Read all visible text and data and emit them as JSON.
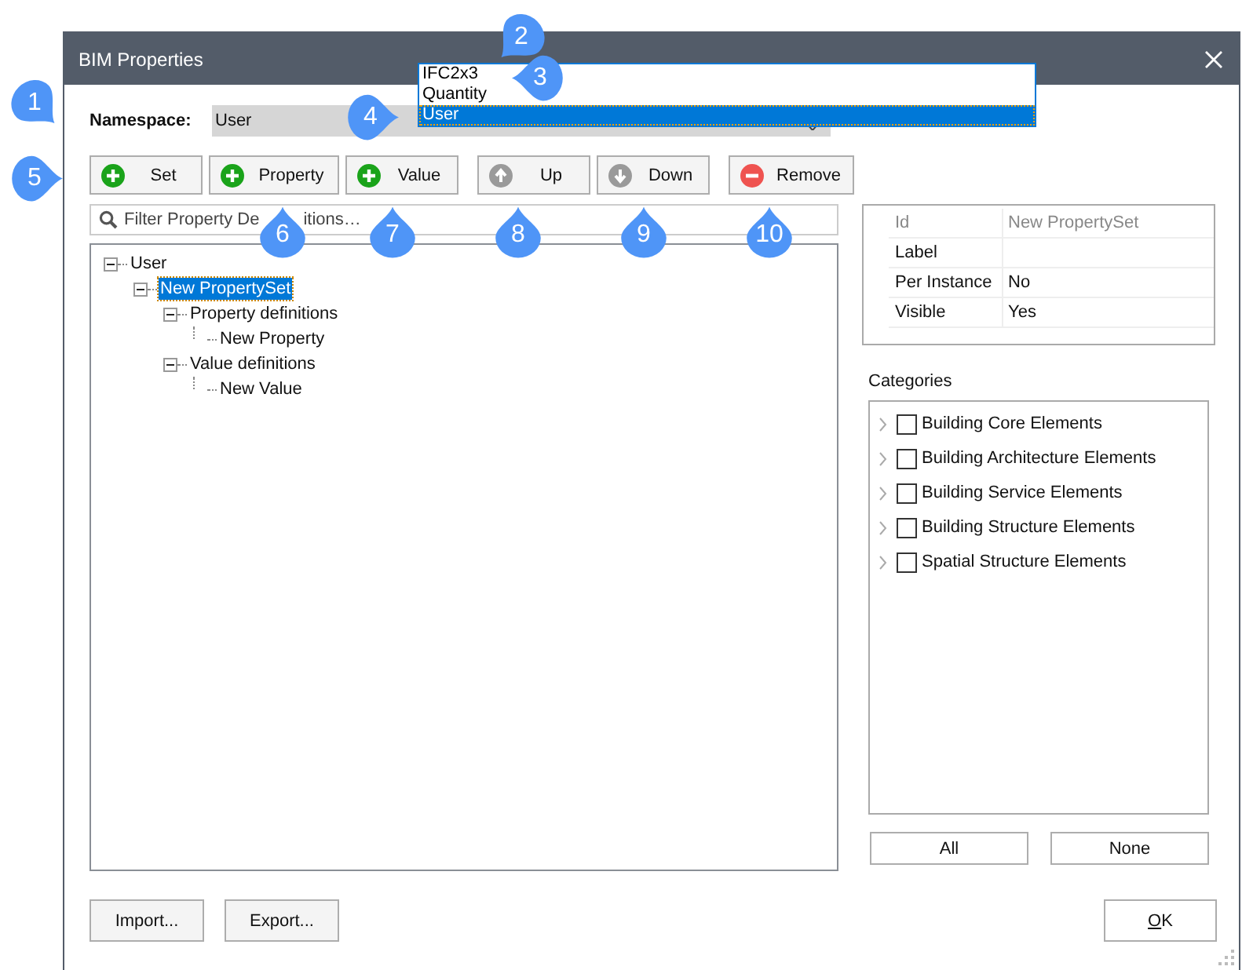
{
  "window": {
    "title": "BIM Properties"
  },
  "namespace": {
    "label": "Namespace:",
    "value": "User",
    "options": [
      {
        "label": "IFC2x3",
        "selected": false
      },
      {
        "label": "Quantity",
        "selected": false
      },
      {
        "label": "User",
        "selected": true
      }
    ]
  },
  "toolbar": [
    {
      "label": "Set",
      "kind": "add"
    },
    {
      "label": "Property",
      "kind": "add"
    },
    {
      "label": "Value",
      "kind": "add"
    },
    {
      "label": "Up",
      "kind": "up"
    },
    {
      "label": "Down",
      "kind": "down"
    },
    {
      "label": "Remove",
      "kind": "remove"
    }
  ],
  "filter": {
    "placeholder_parts": [
      "Filter Property De",
      "itions…"
    ]
  },
  "tree": [
    {
      "label": "User",
      "expanded": true,
      "selected": false,
      "children": [
        {
          "label": "New PropertySet",
          "expanded": true,
          "selected": true,
          "children": [
            {
              "label": "Property definitions",
              "expanded": true,
              "selected": false,
              "children": [
                {
                  "label": "New Property",
                  "selected": false
                }
              ]
            },
            {
              "label": "Value definitions",
              "expanded": true,
              "selected": false,
              "children": [
                {
                  "label": "New Value",
                  "selected": false
                }
              ]
            }
          ]
        }
      ]
    }
  ],
  "properties": [
    {
      "name": "Id",
      "value": "New PropertySet",
      "disabled": true
    },
    {
      "name": "Label",
      "disabled": false
    },
    {
      "name": "Per Instance",
      "value": "No",
      "disabled": false
    },
    {
      "name": "Visible",
      "value": "Yes",
      "disabled": false
    }
  ],
  "categories": {
    "label": "Categories",
    "items": [
      {
        "label": "Building Core Elements",
        "checked": false
      },
      {
        "label": "Building Architecture Elements",
        "checked": false
      },
      {
        "label": "Building Service Elements",
        "checked": false
      },
      {
        "label": "Building Structure Elements",
        "checked": false
      },
      {
        "label": "Spatial Structure Elements",
        "checked": false
      }
    ],
    "buttons": [
      "All",
      "None"
    ]
  },
  "footer": {
    "left": [
      "Import...",
      "Export..."
    ],
    "ok": "OK"
  },
  "callouts": [
    {
      "label": "1",
      "kind": "lowerright"
    },
    {
      "label": "2",
      "kind": "lowerleft"
    },
    {
      "label": "3",
      "kind": "left"
    },
    {
      "label": "4",
      "kind": "right"
    },
    {
      "label": "5",
      "kind": "right"
    },
    {
      "label": "6",
      "kind": "up"
    },
    {
      "label": "7",
      "kind": "up"
    },
    {
      "label": "8",
      "kind": "up"
    },
    {
      "label": "9",
      "kind": "up"
    },
    {
      "label": "10",
      "kind": "up"
    }
  ]
}
